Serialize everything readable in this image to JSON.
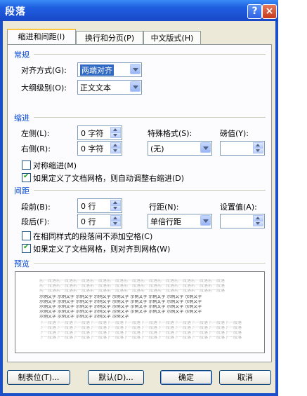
{
  "window": {
    "title": "段落"
  },
  "titlebar": {
    "help": "?",
    "close": "×"
  },
  "tabs": [
    {
      "label": "缩进和间距(I)",
      "active": true
    },
    {
      "label": "换行和分页(P)",
      "active": false
    },
    {
      "label": "中文版式(H)",
      "active": false
    }
  ],
  "general": {
    "title": "常规",
    "alignment_label": "对齐方式(G):",
    "alignment_value": "两端对齐",
    "outline_label": "大纲级别(O):",
    "outline_value": "正文文本"
  },
  "indent": {
    "title": "缩进",
    "left_label": "左侧(L):",
    "left_value": "0 字符",
    "right_label": "右侧(R):",
    "right_value": "0 字符",
    "special_label": "特殊格式(S):",
    "special_value": "(无)",
    "by_label": "磅值(Y):",
    "by_value": "",
    "mirror_label": "对称缩进(M)",
    "mirror_checked": false,
    "grid_label": "如果定义了文档网格，则自动调整右缩进(D)",
    "grid_checked": true
  },
  "spacing": {
    "title": "间距",
    "before_label": "段前(B):",
    "before_value": "0 行",
    "after_label": "段后(F):",
    "after_value": "0 行",
    "line_label": "行距(N):",
    "line_value": "单倍行距",
    "at_label": "设置值(A):",
    "at_value": "",
    "nospace_label": "在相同样式的段落间不添加空格(C)",
    "nospace_checked": false,
    "snap_label": "如果定义了文档网格，则对齐到网格(W)",
    "snap_checked": true
  },
  "preview": {
    "title": "预览",
    "prev_line": "前一段落前一段落前一段落前一段落前一段落前一段落前一段落前一段落前一段落前一段落前一段落",
    "sample_line": "示例文字 示例文字 示例文字 示例文字 示例文字 示例文字 示例文字 示例文字 示例文字",
    "sample_last": "示例文字 示例文字 示例文字 示例文字 示例文字",
    "next_line": "下一段落下一段落下一段落下一段落下一段落下一段落下一段落下一段落下一段落下一段落下一段落下一段落"
  },
  "buttons": {
    "tabs": "制表位(T)...",
    "default": "默认(D)...",
    "ok": "确定",
    "cancel": "取消"
  }
}
